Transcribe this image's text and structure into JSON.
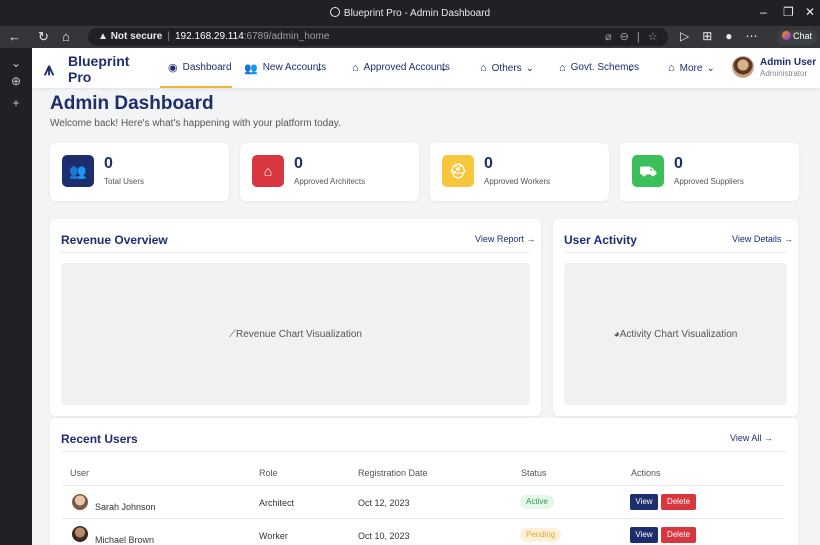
{
  "browser": {
    "window_title": "Blueprint Pro - Admin Dashboard",
    "security_label": "Not secure",
    "url_host": "192.168.29.114",
    "url_path": ":6789/admin_home",
    "chat_label": "Chat"
  },
  "brand": {
    "name": "Blueprint Pro"
  },
  "nav": {
    "dashboard": "Dashboard",
    "new_accounts": "New Accounts",
    "approved_accounts": "Approved Accounts",
    "others": "Others",
    "govt_schemes": "Govt. Schemes",
    "more": "More"
  },
  "user": {
    "name": "Admin User",
    "role": "Administrator"
  },
  "header": {
    "title": "Admin Dashboard",
    "subtitle": "Welcome back! Here's what's happening with your platform today."
  },
  "stats": [
    {
      "value": "0",
      "label": "Total Users",
      "color": "#1e2d6e",
      "icon": "users-icon"
    },
    {
      "value": "0",
      "label": "Approved Architects",
      "color": "#d9373f",
      "icon": "home-icon"
    },
    {
      "value": "0",
      "label": "Approved Workers",
      "color": "#f7c63d",
      "icon": "hardhat-icon"
    },
    {
      "value": "0",
      "label": "Approved Suppliers",
      "color": "#3bbf5b",
      "icon": "truck-icon"
    }
  ],
  "revenue": {
    "title": "Revenue Overview",
    "link": "View Report →",
    "placeholder": "Revenue Chart Visualization"
  },
  "activity": {
    "title": "User Activity",
    "link": "View Details →",
    "placeholder": "Activity Chart Visualization"
  },
  "recent_users": {
    "title": "Recent Users",
    "link": "View All →",
    "columns": [
      "User",
      "Role",
      "Registration Date",
      "Status",
      "Actions"
    ],
    "rows": [
      {
        "name": "Sarah Johnson",
        "role": "Architect",
        "date": "Oct 12, 2023",
        "status": "Active",
        "view": "View",
        "delete": "Delete"
      },
      {
        "name": "Michael Brown",
        "role": "Worker",
        "date": "Oct 10, 2023",
        "status": "Pending",
        "view": "View",
        "delete": "Delete"
      }
    ]
  },
  "colors": {
    "primary": "#1e2d6e",
    "accent": "#f2b53a",
    "danger": "#d9373f"
  }
}
